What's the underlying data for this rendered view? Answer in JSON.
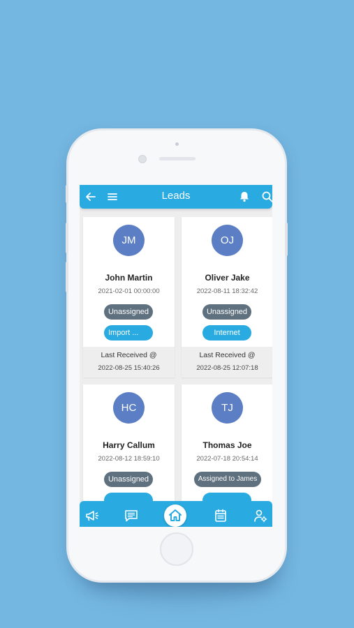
{
  "header": {
    "title": "Leads"
  },
  "leads": [
    {
      "initials": "JM",
      "name": "John Martin",
      "date": "2021-02-01 00:00:00",
      "status": "Unassigned",
      "source": "Import ...",
      "last_label": "Last Received @",
      "last_time": "2022-08-25 15:40:26"
    },
    {
      "initials": "OJ",
      "name": "Oliver Jake",
      "date": "2022-08-11 18:32:42",
      "status": "Unassigned",
      "source": "Internet",
      "last_label": "Last Received @",
      "last_time": "2022-08-25 12:07:18"
    },
    {
      "initials": "HC",
      "name": "Harry Callum",
      "date": "2022-08-12 18:59:10",
      "status": "Unassigned",
      "source": ""
    },
    {
      "initials": "TJ",
      "name": "Thomas Joe",
      "date": "2022-07-18 20:54:14",
      "status": "Assigned to James",
      "source": ""
    }
  ],
  "nav": [
    "megaphone-icon",
    "chat-icon",
    "home-icon",
    "calendar-icon",
    "user-settings-icon"
  ],
  "colors": {
    "accent": "#29aae1",
    "avatar": "#5b7ec4",
    "status_pill": "#5f707e",
    "background": "#74b7e1"
  }
}
